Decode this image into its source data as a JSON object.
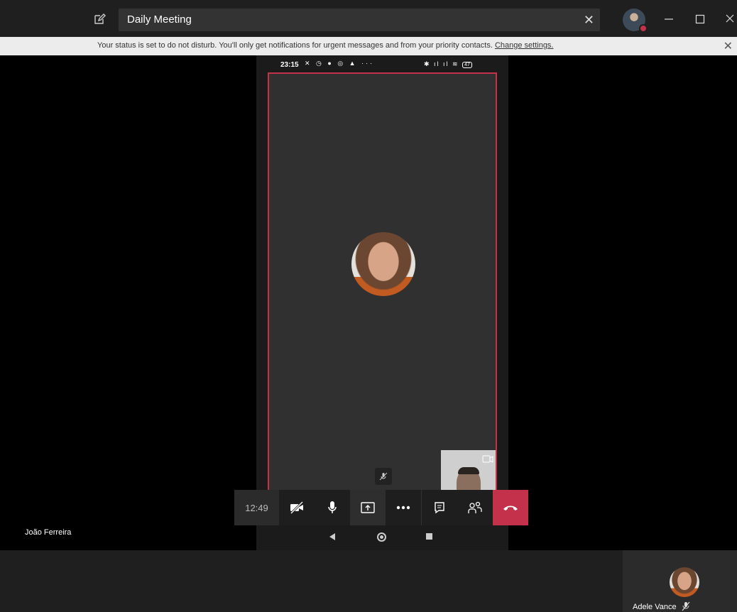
{
  "titlebar": {
    "meeting_title": "Daily Meeting",
    "compose_icon": "compose-icon",
    "clear_icon": "close-icon",
    "user_presence": "do-not-disturb",
    "window_controls": [
      "minimize-icon",
      "maximize-icon",
      "close-icon"
    ]
  },
  "notice": {
    "text": "Your status is set to do not disturb. You'll only get notifications for urgent messages and from your priority contacts. ",
    "link": "Change settings.",
    "close_icon": "close-icon"
  },
  "phone": {
    "time": "23:15",
    "battery": "47",
    "status_left_glyphs": "✕ ◷ ● ◎ ▲ ···",
    "status_right_glyphs": "✱ ıl ıl ≋"
  },
  "participant": {
    "name": "João Ferreira"
  },
  "controls": {
    "timer": "12:49",
    "buttons": [
      "video-off-icon",
      "microphone-icon",
      "share-screen-icon",
      "more-icon",
      "chat-icon",
      "participants-icon",
      "hang-up-icon"
    ]
  },
  "tile": {
    "name": "Adele Vance",
    "mic_state": "muted"
  },
  "colors": {
    "accent_red": "#c4314b",
    "titlebar": "#1f1f1f",
    "notice_bg": "#ececec"
  }
}
